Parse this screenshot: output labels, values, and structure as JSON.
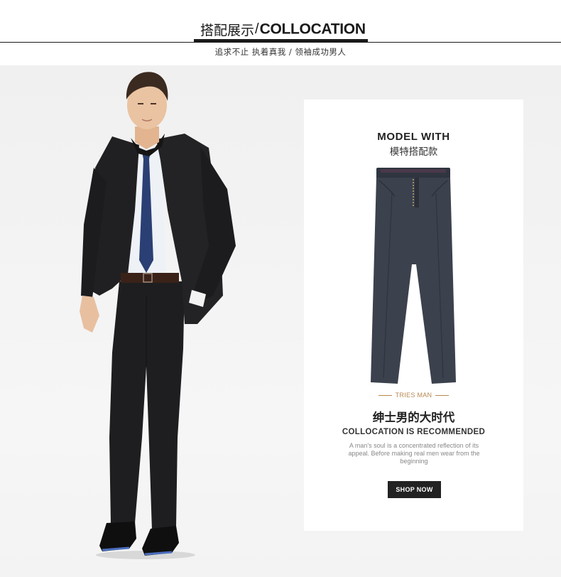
{
  "header": {
    "title_cn": "搭配展示",
    "title_sep": "/",
    "title_en": "COLLOCATION",
    "subtitle": "追求不止 执着真我 / 领袖成功男人"
  },
  "model": {
    "icon": "male-model-photo"
  },
  "card": {
    "title_en": "MODEL WITH",
    "title_cn": "模特搭配款",
    "product_icon": "trousers-product-photo",
    "brand": "TRIES MAN",
    "slogan_cn": "绅士男的大时代",
    "slogan_en": "COLLOCATION IS RECOMMENDED",
    "description": "A man's soul is a concentrated reflection of its appeal. Before making real men wear from the beginning",
    "button_label": "SHOP NOW"
  },
  "colors": {
    "accent_gold": "#b8874f",
    "text_dark": "#222222",
    "button_bg": "#222222",
    "stage_bg": "#f0f0f0"
  }
}
